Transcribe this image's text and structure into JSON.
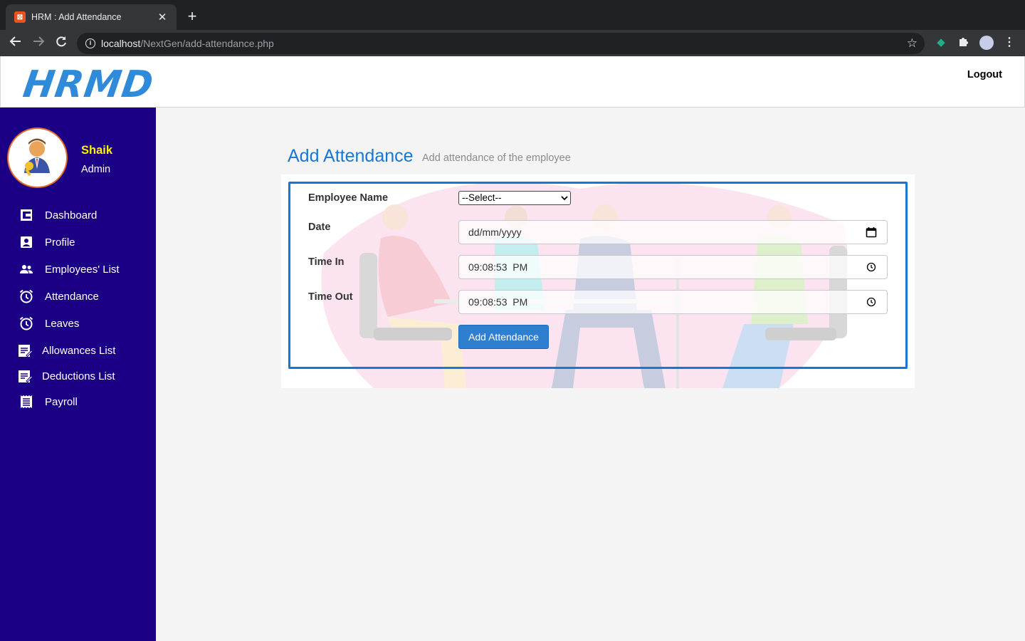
{
  "browser": {
    "tab_title": "HRM : Add Attendance",
    "tab_favicon": "xampp-icon",
    "url_host": "localhost",
    "url_path": "/NextGen/add-attendance.php"
  },
  "header": {
    "logo_text": "HRMD",
    "logout_label": "Logout"
  },
  "sidebar": {
    "user_name": "Shaik",
    "user_role": "Admin",
    "items": [
      {
        "label": "Dashboard",
        "icon": "dashboard-icon"
      },
      {
        "label": "Profile",
        "icon": "profile-icon"
      },
      {
        "label": "Employees' List",
        "icon": "people-icon"
      },
      {
        "label": "Attendance",
        "icon": "alarm-icon"
      },
      {
        "label": "Leaves",
        "icon": "alarm-icon"
      },
      {
        "label": "Allowances List",
        "icon": "note-icon"
      },
      {
        "label": "Deductions List",
        "icon": "note-icon"
      },
      {
        "label": "Payroll",
        "icon": "receipt-icon"
      }
    ]
  },
  "main": {
    "title": "Add Attendance",
    "subtitle": "Add attendance of the employee",
    "form": {
      "employee_label": "Employee Name",
      "employee_value": "--Select--",
      "date_label": "Date",
      "date_value": "dd/mm/yyyy",
      "time_in_label": "Time In",
      "time_in_value": "09:08:53  PM",
      "time_out_label": "Time Out",
      "time_out_value": "09:08:53  PM",
      "submit_label": "Add Attendance"
    }
  },
  "colors": {
    "sidebar_bg": "#1b0086",
    "accent": "#1877d2",
    "name_highlight": "#fff200"
  }
}
